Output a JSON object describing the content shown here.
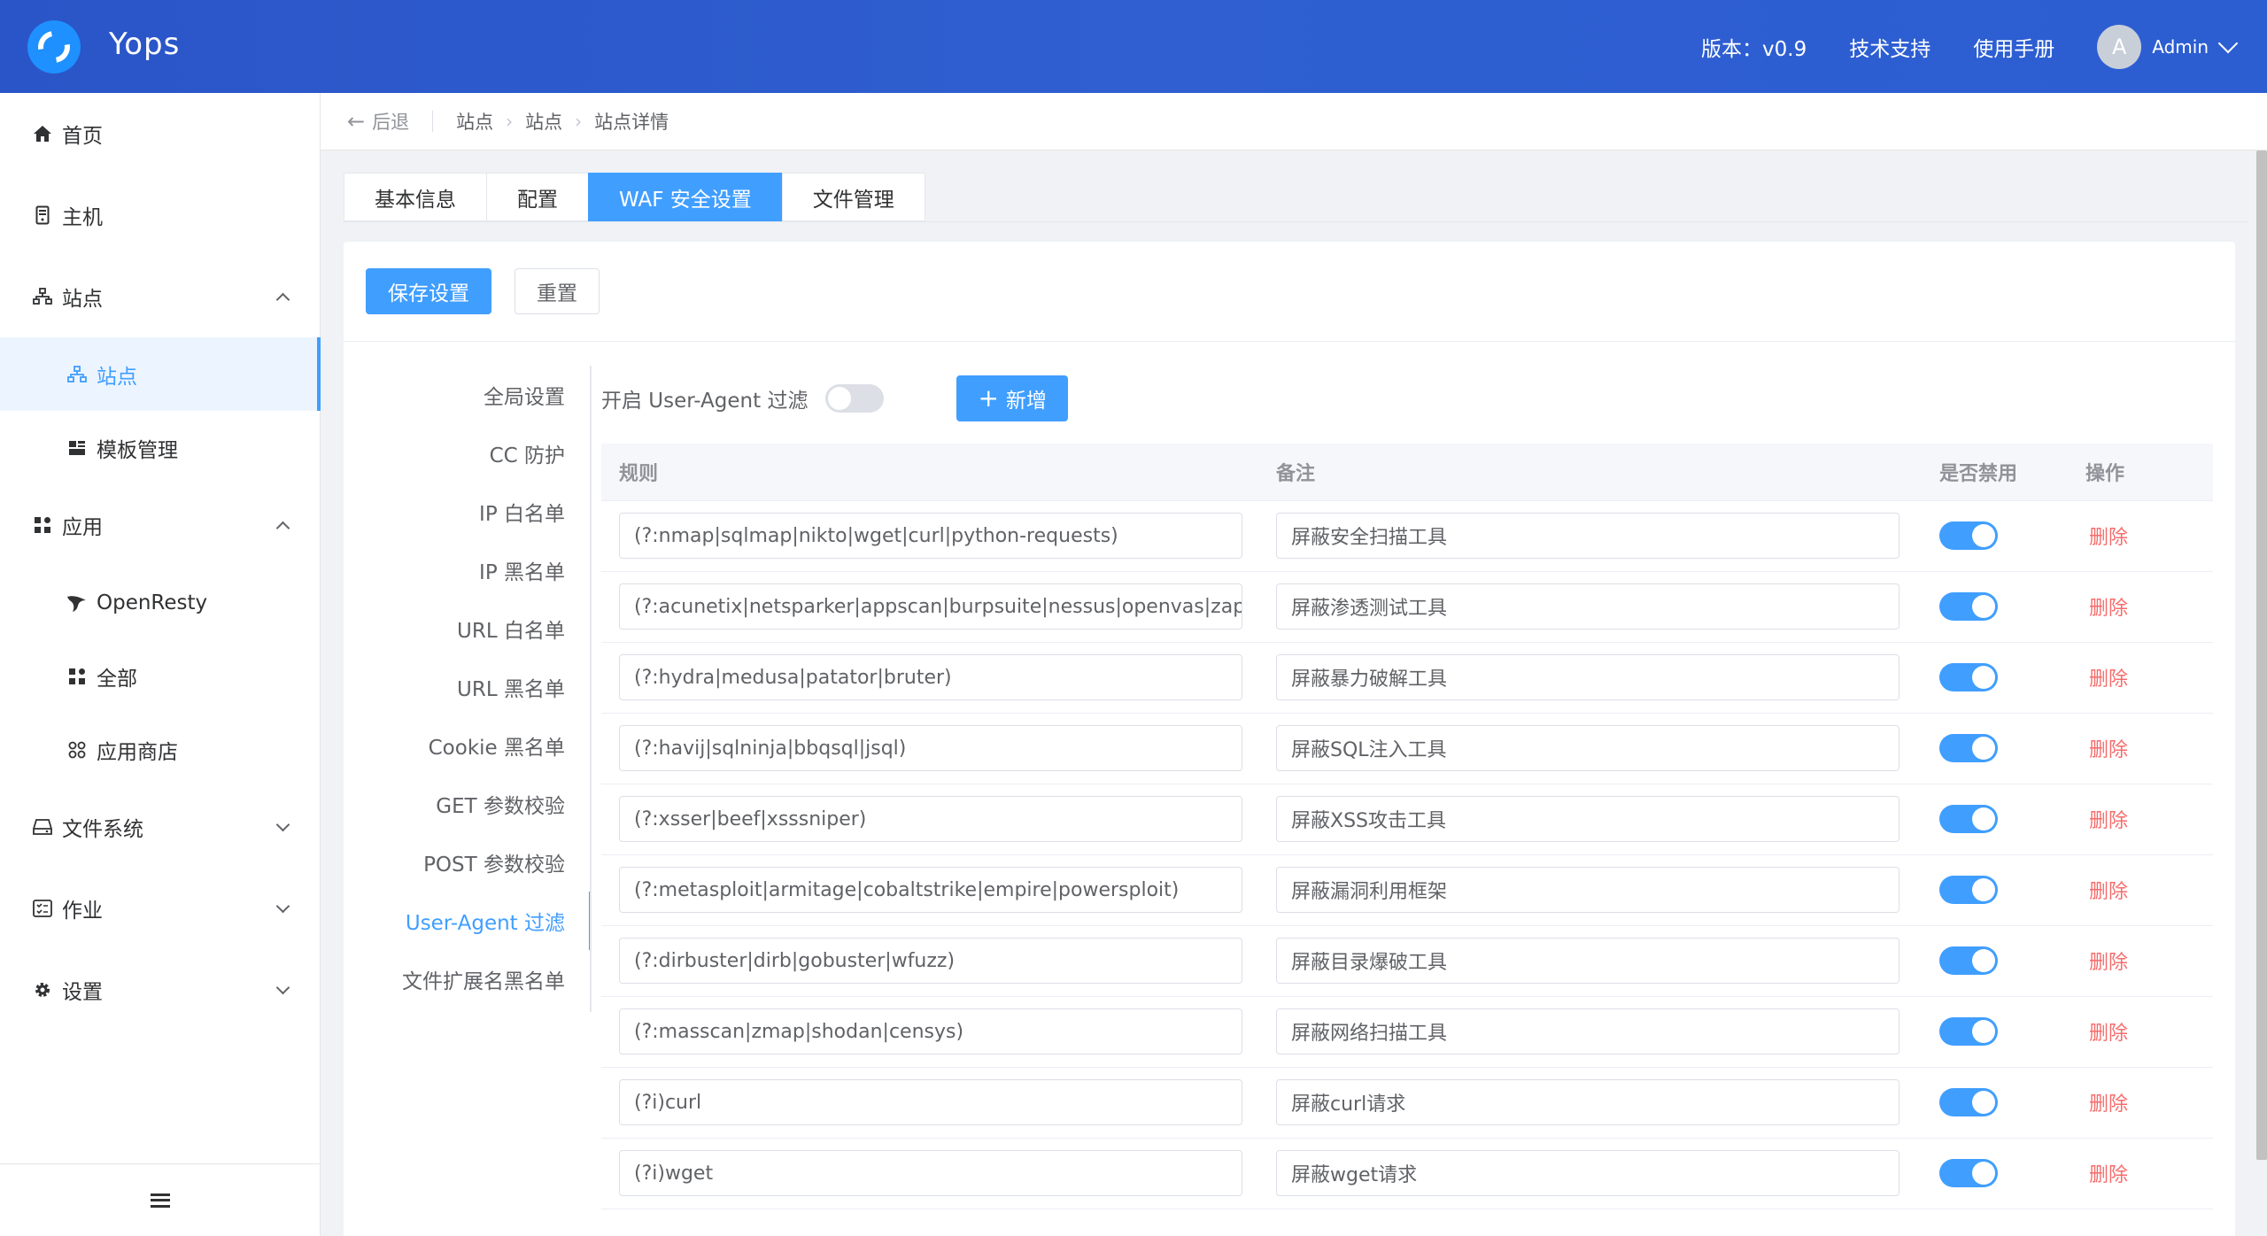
{
  "header": {
    "app_name": "Yops",
    "version": "版本：v0.9",
    "support": "技术支持",
    "manual": "使用手册",
    "avatar_letter": "A",
    "user": "Admin"
  },
  "sidebar": {
    "items": [
      {
        "label": "首页",
        "icon": "home-icon"
      },
      {
        "label": "主机",
        "icon": "server-icon"
      },
      {
        "label": "站点",
        "icon": "sitemap-icon"
      },
      {
        "label": "站点",
        "icon": "sitemap-icon"
      },
      {
        "label": "模板管理",
        "icon": "template-icon"
      },
      {
        "label": "应用",
        "icon": "apps-icon"
      },
      {
        "label": "OpenResty",
        "icon": "openresty-icon"
      },
      {
        "label": "全部",
        "icon": "apps-icon"
      },
      {
        "label": "应用商店",
        "icon": "store-icon"
      },
      {
        "label": "文件系统",
        "icon": "disk-icon"
      },
      {
        "label": "作业",
        "icon": "job-icon"
      },
      {
        "label": "设置",
        "icon": "gear-icon"
      }
    ]
  },
  "breadcrumb": {
    "back": "后退",
    "items": [
      "站点",
      "站点",
      "站点详情"
    ]
  },
  "tabs": [
    "基本信息",
    "配置",
    "WAF 安全设置",
    "文件管理"
  ],
  "actions": {
    "save": "保存设置",
    "reset": "重置"
  },
  "submenu": [
    "全局设置",
    "CC 防护",
    "IP 白名单",
    "IP 黑名单",
    "URL 白名单",
    "URL 黑名单",
    "Cookie 黑名单",
    "GET 参数校验",
    "POST 参数校验",
    "User-Agent 过滤",
    "文件扩展名黑名单"
  ],
  "toolbar": {
    "toggle_label": "开启 User-Agent 过滤",
    "add": "新增"
  },
  "table": {
    "headers": [
      "规则",
      "备注",
      "是否禁用",
      "操作"
    ],
    "delete_label": "删除",
    "rows": [
      {
        "rule": "(?:nmap|sqlmap|nikto|wget|curl|python-requests)",
        "note": "屏蔽安全扫描工具"
      },
      {
        "rule": "(?:acunetix|netsparker|appscan|burpsuite|nessus|openvas|zap)",
        "note": "屏蔽渗透测试工具"
      },
      {
        "rule": "(?:hydra|medusa|patator|bruter)",
        "note": "屏蔽暴力破解工具"
      },
      {
        "rule": "(?:havij|sqlninja|bbqsql|jsql)",
        "note": "屏蔽SQL注入工具"
      },
      {
        "rule": "(?:xsser|beef|xsssniper)",
        "note": "屏蔽XSS攻击工具"
      },
      {
        "rule": "(?:metasploit|armitage|cobaltstrike|empire|powersploit)",
        "note": "屏蔽漏洞利用框架"
      },
      {
        "rule": "(?:dirbuster|dirb|gobuster|wfuzz)",
        "note": "屏蔽目录爆破工具"
      },
      {
        "rule": "(?:masscan|zmap|shodan|censys)",
        "note": "屏蔽网络扫描工具"
      },
      {
        "rule": "(?i)curl",
        "note": "屏蔽curl请求"
      },
      {
        "rule": "(?i)wget",
        "note": "屏蔽wget请求"
      }
    ]
  }
}
